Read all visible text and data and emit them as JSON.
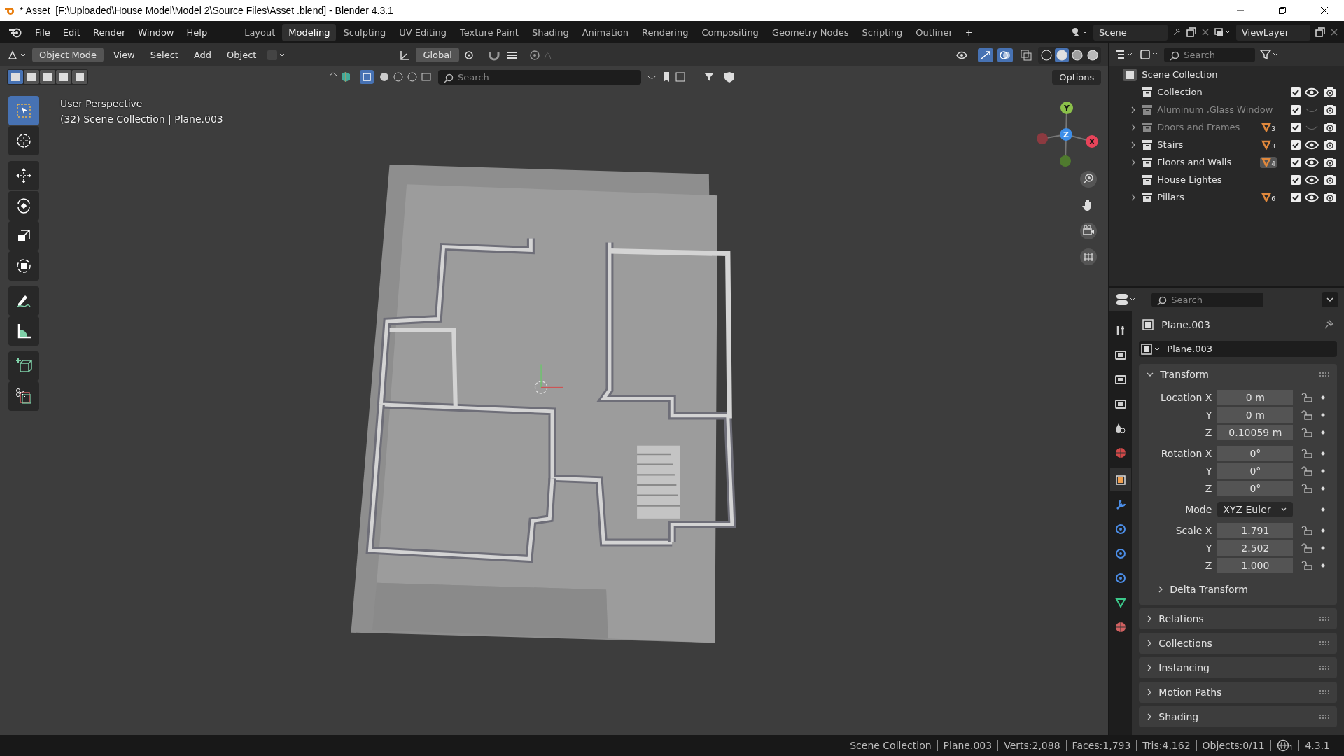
{
  "window": {
    "title": "* Asset  [F:\\Uploaded\\House Model\\Model 2\\Source Files\\Asset .blend] - Blender 4.3.1"
  },
  "menu": [
    "File",
    "Edit",
    "Render",
    "Window",
    "Help"
  ],
  "workspaces": [
    {
      "label": "Layout",
      "selected": false
    },
    {
      "label": "Modeling",
      "selected": true
    },
    {
      "label": "Sculpting",
      "selected": false
    },
    {
      "label": "UV Editing",
      "selected": false
    },
    {
      "label": "Texture Paint",
      "selected": false
    },
    {
      "label": "Shading",
      "selected": false
    },
    {
      "label": "Animation",
      "selected": false
    },
    {
      "label": "Rendering",
      "selected": false
    },
    {
      "label": "Compositing",
      "selected": false
    },
    {
      "label": "Geometry Nodes",
      "selected": false
    },
    {
      "label": "Scripting",
      "selected": false
    },
    {
      "label": "Outliner",
      "selected": false
    }
  ],
  "add_workspace": "+",
  "scene": "Scene",
  "view_layer": "ViewLayer",
  "viewport": {
    "mode": "Object Mode",
    "menus": [
      "View",
      "Select",
      "Add",
      "Object"
    ],
    "orientation": "Global",
    "search_placeholder": "Search",
    "options": "Options",
    "select_modes": [
      {
        "selected": true
      },
      {
        "selected": false
      },
      {
        "selected": false
      },
      {
        "selected": false
      },
      {
        "selected": false
      }
    ],
    "shading": [
      {
        "kind": "wireframe",
        "selected": false
      },
      {
        "kind": "solid",
        "selected": true
      },
      {
        "kind": "material",
        "selected": false
      },
      {
        "kind": "rendered",
        "selected": false
      }
    ],
    "info": [
      "User Perspective",
      "(32) Scene Collection | Plane.003"
    ],
    "gizmo": [
      {
        "label": "Y"
      },
      {
        "label": "Z"
      },
      {
        "label": "X"
      }
    ]
  },
  "tools": [
    {
      "kind": "select",
      "selected": true
    },
    {
      "kind": "cursor",
      "selected": false
    },
    {
      "kind": "move",
      "selected": false
    },
    {
      "kind": "rotate",
      "selected": false
    },
    {
      "kind": "scale",
      "selected": false
    },
    {
      "kind": "transform",
      "selected": false
    },
    {
      "kind": "annotate",
      "selected": false
    },
    {
      "kind": "measure",
      "selected": false
    },
    {
      "kind": "add-cube",
      "selected": false
    },
    {
      "kind": "cut",
      "selected": false
    }
  ],
  "outliner": {
    "search_placeholder": "Search",
    "root": "Scene Collection",
    "items": [
      {
        "name": "Collection",
        "expandable": false,
        "disabled": false,
        "checked": true,
        "visible": true
      },
      {
        "name": "Aluminum ,Glass Window",
        "expandable": true,
        "disabled": true,
        "checked": true,
        "visible": false
      },
      {
        "name": "Doors and Frames",
        "expandable": true,
        "disabled": true,
        "checked": true,
        "visible": false,
        "badge": "3",
        "badge_active": false
      },
      {
        "name": "Stairs",
        "expandable": true,
        "disabled": false,
        "checked": true,
        "visible": true,
        "badge": "3",
        "badge_active": false
      },
      {
        "name": "Floors and Walls",
        "expandable": true,
        "disabled": false,
        "checked": true,
        "visible": true,
        "badge": "4",
        "badge_active": true
      },
      {
        "name": "House Lightes",
        "expandable": false,
        "disabled": false,
        "checked": true,
        "visible": true
      },
      {
        "name": "Pillars",
        "expandable": true,
        "disabled": false,
        "checked": true,
        "visible": true,
        "badge": "6",
        "badge_active": false
      }
    ]
  },
  "properties": {
    "search_placeholder": "Search",
    "tabs": [
      {
        "kind": "tool",
        "selected": false
      },
      {
        "kind": "render",
        "selected": false
      },
      {
        "kind": "output",
        "selected": false
      },
      {
        "kind": "view-layer",
        "selected": false
      },
      {
        "kind": "scene",
        "selected": false
      },
      {
        "kind": "world",
        "selected": false
      },
      {
        "kind": "object",
        "selected": true
      },
      {
        "kind": "modifiers",
        "selected": false
      },
      {
        "kind": "particles",
        "selected": false
      },
      {
        "kind": "physics",
        "selected": false
      },
      {
        "kind": "constraints",
        "selected": false
      },
      {
        "kind": "data",
        "selected": false
      },
      {
        "kind": "material",
        "selected": false
      }
    ],
    "object_name": "Plane.003",
    "data_name": "Plane.003",
    "transform": {
      "title": "Transform",
      "groups": [
        [
          {
            "kind": "number",
            "label": "Location X",
            "value": "0 m"
          },
          {
            "kind": "number",
            "label": "Y",
            "value": "0 m"
          },
          {
            "kind": "number",
            "label": "Z",
            "value": "0.10059 m"
          }
        ],
        [
          {
            "kind": "number",
            "label": "Rotation X",
            "value": "0°"
          },
          {
            "kind": "number",
            "label": "Y",
            "value": "0°"
          },
          {
            "kind": "number",
            "label": "Z",
            "value": "0°"
          }
        ],
        [
          {
            "kind": "dropdown",
            "label": "Mode",
            "value": "XYZ Euler"
          }
        ],
        [
          {
            "kind": "number",
            "label": "Scale X",
            "value": "1.791"
          },
          {
            "kind": "number",
            "label": "Y",
            "value": "2.502"
          },
          {
            "kind": "number",
            "label": "Z",
            "value": "1.000"
          }
        ]
      ],
      "subpanel": "Delta Transform"
    },
    "panels": [
      "Relations",
      "Collections",
      "Instancing",
      "Motion Paths",
      "Shading"
    ]
  },
  "status_bar": {
    "items": [
      "Scene Collection",
      "Plane.003",
      "Verts:2,088",
      "Faces:1,793",
      "Tris:4,162",
      "Objects:0/11"
    ],
    "globe_count": "1",
    "version": "4.3.1"
  }
}
